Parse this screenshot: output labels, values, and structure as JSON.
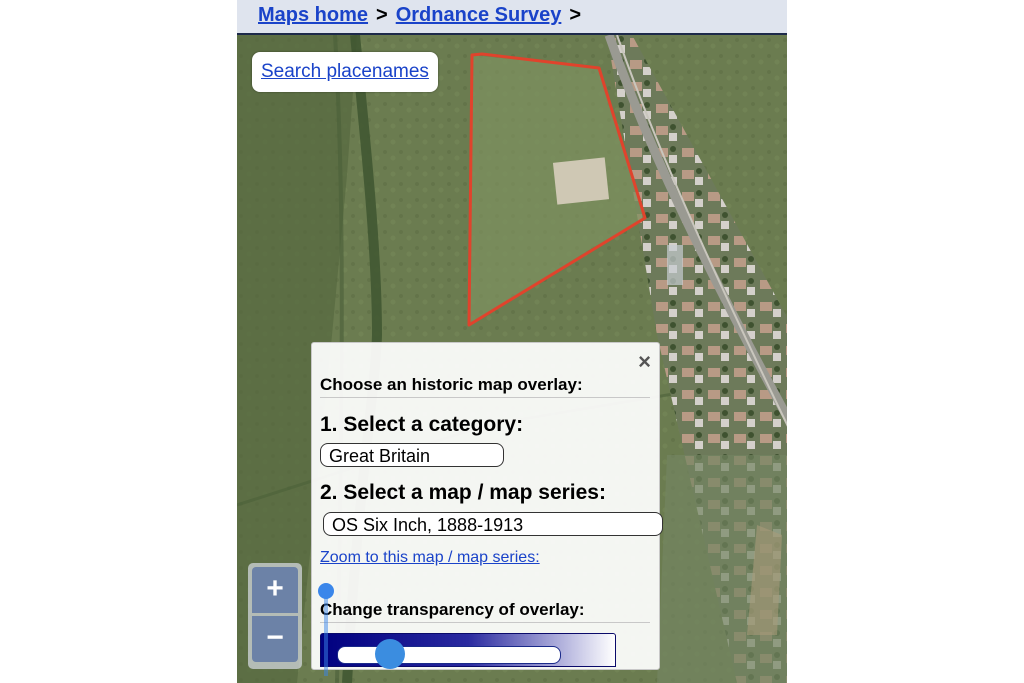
{
  "breadcrumb": {
    "home": "Maps home",
    "separator": ">",
    "section": "Ordnance Survey",
    "trailing": ">"
  },
  "search": {
    "label": "Search placenames"
  },
  "zoom": {
    "in_label": "+",
    "out_label": "−"
  },
  "overlay_panel": {
    "close_label": "×",
    "title": "Choose an historic map overlay:",
    "step1_heading": "1. Select a category:",
    "category_value": "Great Britain",
    "step2_heading": "2. Select a map / map series:",
    "series_value": "OS Six Inch, 1888-1913",
    "zoom_link": "Zoom to this map / map series:",
    "transparency_heading": "Change transparency of overlay:",
    "transparency_value": 0.2
  },
  "colors": {
    "link": "#1a43c9",
    "boundary": "#e0432c",
    "marker": "#3a86ea",
    "header_bg": "#dfe4ee"
  },
  "icons": [
    "close-icon",
    "plus-icon",
    "minus-icon",
    "location-marker-icon"
  ]
}
